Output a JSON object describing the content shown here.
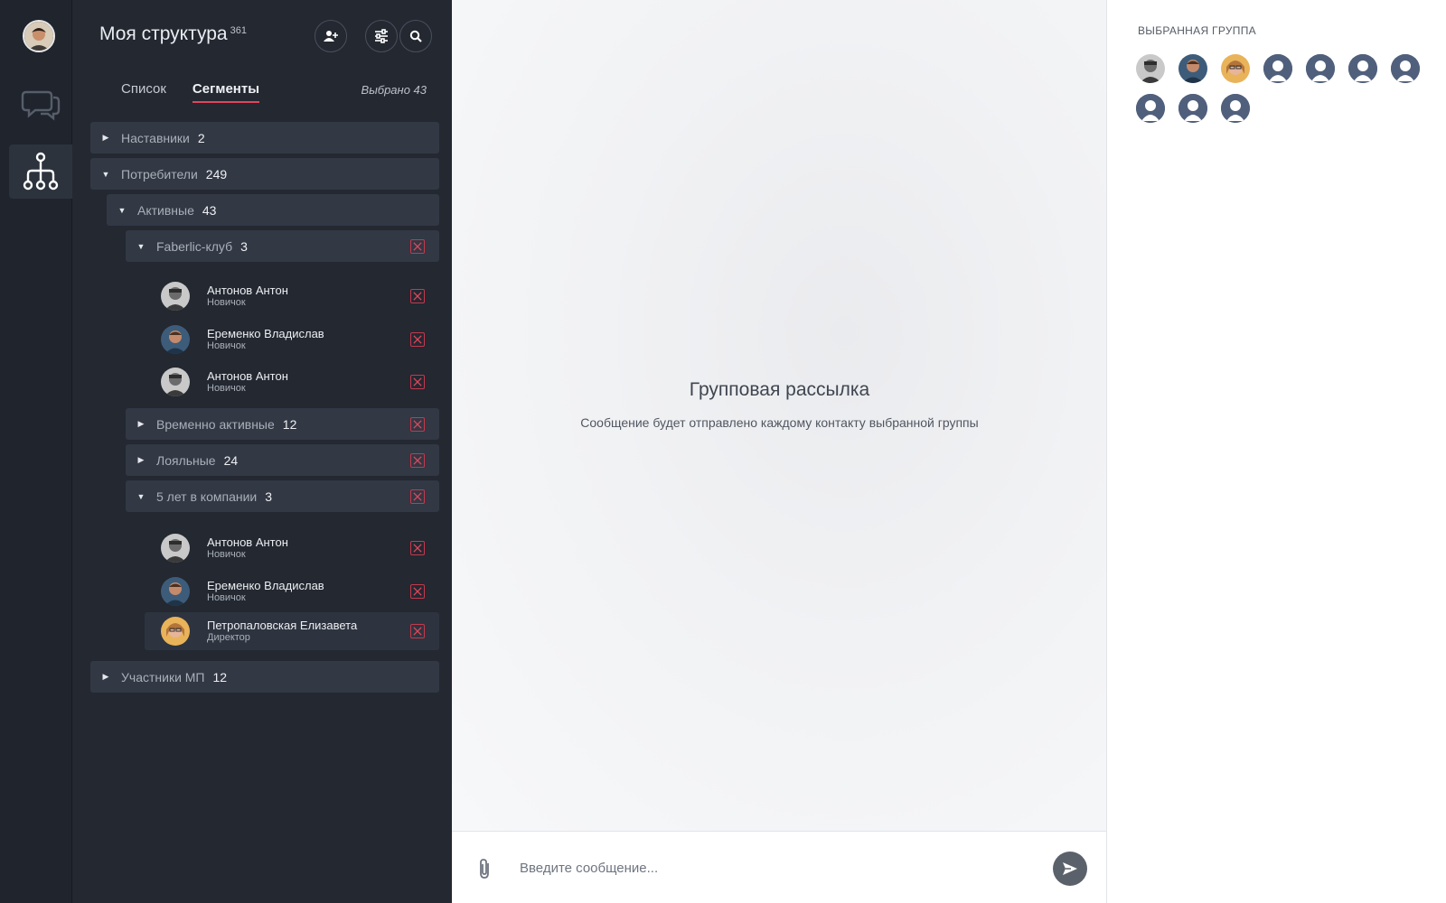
{
  "sidebar": {
    "title": "Моя структура",
    "title_count": "361",
    "tabs": [
      {
        "label": "Список",
        "active": false
      },
      {
        "label": "Сегменты",
        "active": true
      }
    ],
    "selected_label": "Выбрано 43"
  },
  "tree": {
    "mentors": {
      "name": "Наставники",
      "count": "2"
    },
    "consumers": {
      "name": "Потребители",
      "count": "249"
    },
    "active": {
      "name": "Активные",
      "count": "43"
    },
    "faberlic": {
      "name": "Faberlic-клуб",
      "count": "3",
      "members": [
        {
          "name": "Антонов Антон",
          "role": "Новичок"
        },
        {
          "name": "Еременко Владислав",
          "role": "Новичок"
        },
        {
          "name": "Антонов Антон",
          "role": "Новичок"
        }
      ]
    },
    "temp_active": {
      "name": "Временно активные",
      "count": "12"
    },
    "loyal": {
      "name": "Лояльные",
      "count": "24"
    },
    "five_years": {
      "name": "5 лет в компании",
      "count": "3",
      "members": [
        {
          "name": "Антонов Антон",
          "role": "Новичок"
        },
        {
          "name": "Еременко Владислав",
          "role": "Новичок"
        },
        {
          "name": "Петропаловская Елизавета",
          "role": "Директор"
        }
      ]
    },
    "mp_members": {
      "name": "Участники МП",
      "count": "12"
    }
  },
  "center": {
    "title": "Групповая рассылка",
    "subtitle": "Сообщение будет отправлено каждому контакту выбранной группы"
  },
  "composer": {
    "placeholder": "Введите сообщение..."
  },
  "right_panel": {
    "title": "ВЫБРАННАЯ ГРУППА",
    "member_avatars": [
      "photo-man-gray",
      "photo-man-blue",
      "photo-woman-glasses",
      "generic-avatar",
      "generic-avatar",
      "generic-avatar",
      "generic-avatar",
      "generic-avatar",
      "generic-avatar",
      "generic-avatar"
    ]
  },
  "colors": {
    "accent": "#e0465c",
    "sidebar_bg": "#232831",
    "rail_bg": "#1f242d",
    "group_bg": "#323844"
  }
}
